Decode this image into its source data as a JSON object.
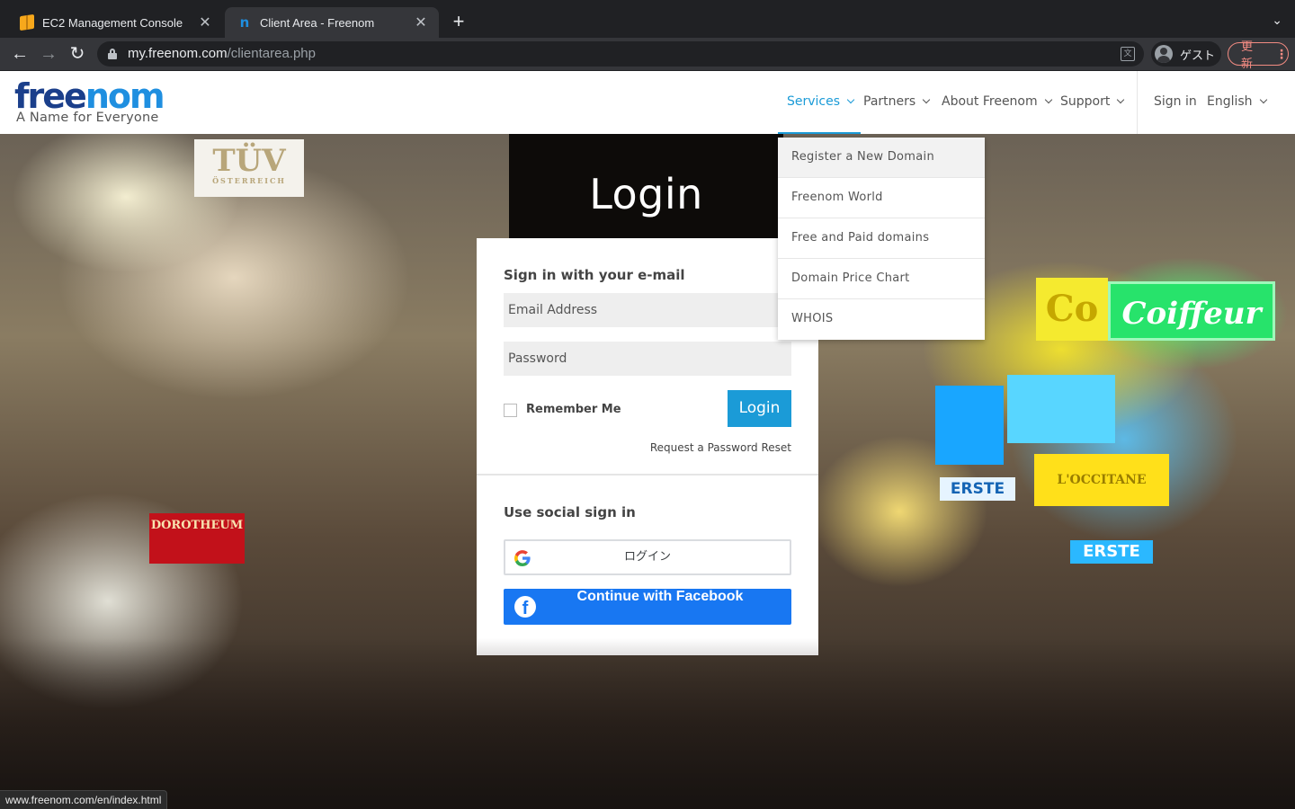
{
  "browser": {
    "tabs": [
      {
        "title": "EC2 Management Console",
        "icon": "aws-icon",
        "active": false
      },
      {
        "title": "Client Area - Freenom",
        "icon": "freenom-icon",
        "active": true
      }
    ],
    "url_host": "my.freenom.com",
    "url_path": "/clientarea.php",
    "profile_label": "ゲスト",
    "update_label": "更新",
    "status_url": "www.freenom.com/en/index.html"
  },
  "site": {
    "logo_word_a": "free",
    "logo_word_b": "nom",
    "logo_tagline": "A Name for Everyone",
    "nav": [
      {
        "label": "Services",
        "has_chevron": true,
        "active": true
      },
      {
        "label": "Partners",
        "has_chevron": true,
        "active": false
      },
      {
        "label": "About Freenom",
        "has_chevron": true,
        "active": false
      },
      {
        "label": "Support",
        "has_chevron": true,
        "active": false
      },
      {
        "label": "Sign in",
        "has_chevron": false,
        "active": false
      },
      {
        "label": "English",
        "has_chevron": true,
        "active": false
      }
    ],
    "accent_color": "#1b9bd7",
    "services_dropdown": [
      "Register a New Domain",
      "Freenom World",
      "Free and Paid domains",
      "Domain Price Chart",
      "WHOIS"
    ]
  },
  "hero": {
    "signs": {
      "tuv": "TÜV",
      "tuv_sub": "ÖSTERREICH",
      "dorotheum": "DOROTHEUM",
      "coiffeur": "Coiffeur",
      "co": "Co",
      "erste": "ERSTE",
      "occitane": "L'OCCITANE"
    }
  },
  "login": {
    "title": "Login",
    "email_heading": "Sign in with your e-mail",
    "email_placeholder": "Email Address",
    "password_placeholder": "Password",
    "remember_label": "Remember Me",
    "login_button": "Login",
    "reset_link": "Request a Password Reset",
    "social_heading": "Use social sign in",
    "google_button": "ログイン",
    "facebook_button": "Continue with Facebook",
    "facebook_color": "#1877f2"
  }
}
